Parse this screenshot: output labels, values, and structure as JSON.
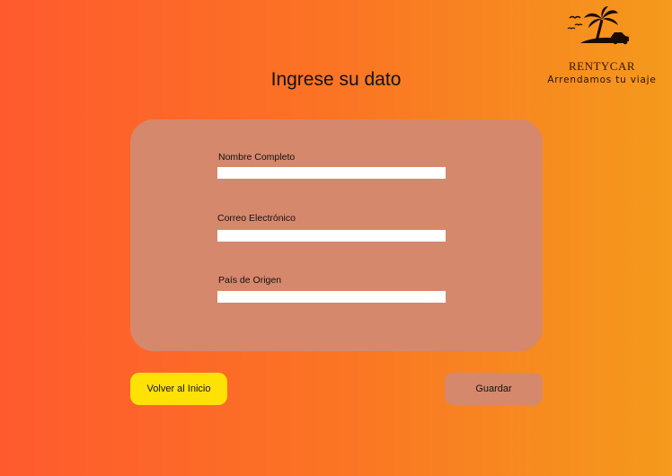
{
  "brand": {
    "name": "RENTYCAR",
    "tagline": "Arrendamos tu viaje",
    "logo_icon": "palm-island-car-icon"
  },
  "page": {
    "title": "Ingrese su dato"
  },
  "form": {
    "fields": [
      {
        "label": "Nombre Completo",
        "value": "",
        "placeholder": ""
      },
      {
        "label": "Correo Electrónico",
        "value": "",
        "placeholder": ""
      },
      {
        "label": "País de Origen",
        "value": "",
        "placeholder": ""
      }
    ]
  },
  "buttons": {
    "home_label": "Volver al Inicio",
    "save_label": "Guardar"
  },
  "colors": {
    "background_start": "#ff5a2e",
    "background_end": "#f49a1c",
    "card": "#d6886c",
    "home_button": "#ffe205",
    "save_button": "#d6886c"
  }
}
